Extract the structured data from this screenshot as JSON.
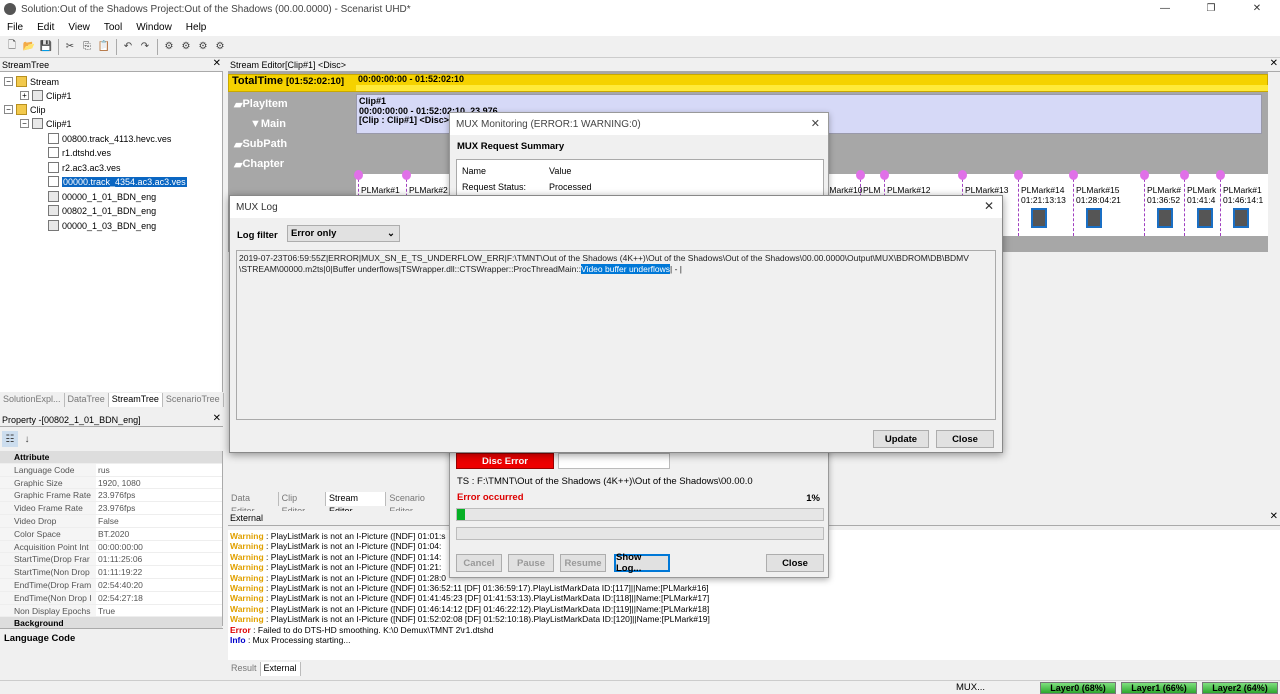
{
  "window": {
    "title": "Solution:Out of the Shadows  Project:Out of the Shadows (00.00.0000) - Scenarist UHD*",
    "min": "—",
    "restore": "❐",
    "close": "✕"
  },
  "menu": [
    "File",
    "Edit",
    "View",
    "Tool",
    "Window",
    "Help"
  ],
  "streamtree": {
    "header": "StreamTree",
    "pin": "📌",
    "close": "✕",
    "nodes": [
      {
        "label": "Stream",
        "box": "−"
      },
      {
        "label": "Clip#1",
        "box": "+"
      },
      {
        "label": "Clip",
        "box": "−"
      },
      {
        "label": "Clip#1",
        "box": "−"
      },
      {
        "label": "00800.track_4113.hevc.ves"
      },
      {
        "label": "r1.dtshd.ves"
      },
      {
        "label": "r2.ac3.ac3.ves"
      },
      {
        "label": "00000.track_4354.ac3.ac3.ves"
      },
      {
        "label": "00000_1_01_BDN_eng"
      },
      {
        "label": "00802_1_01_BDN_eng"
      },
      {
        "label": "00000_1_03_BDN_eng"
      }
    ],
    "tabs": [
      "SolutionExpl...",
      "DataTree",
      "StreamTree",
      "ScenarioTree"
    ]
  },
  "property": {
    "header": "Property -[00802_1_01_BDN_eng]",
    "pin": "📌",
    "close": "✕",
    "rows": [
      {
        "k": "Attribute",
        "v": "",
        "cat": true
      },
      {
        "k": "Language Code",
        "v": "rus"
      },
      {
        "k": "Graphic Size",
        "v": "1920, 1080"
      },
      {
        "k": "Graphic Frame Rate",
        "v": "23.976fps"
      },
      {
        "k": "Video Frame Rate",
        "v": "23.976fps"
      },
      {
        "k": "Video Drop",
        "v": "False"
      },
      {
        "k": "Color Space",
        "v": "BT.2020"
      },
      {
        "k": "Acquisition Point Int",
        "v": "00:00:00:00"
      },
      {
        "k": "StartTime(Drop Frar",
        "v": "01:11:25:06"
      },
      {
        "k": "StartTime(Non Drop",
        "v": "01:11:19:22"
      },
      {
        "k": "EndTime(Drop Fram",
        "v": "02:54:40:20"
      },
      {
        "k": "EndTime(Non Drop I",
        "v": "02:54:27:18"
      },
      {
        "k": "Non Display Epochs",
        "v": "True"
      },
      {
        "k": "Background",
        "v": "",
        "cat": true
      }
    ],
    "desc": "Language Code"
  },
  "streameditor": {
    "header": "Stream Editor[Clip#1] <Disc>",
    "total_label": "TotalTime",
    "total_time": "[01:52:02:10]",
    "range": "00:00:00:00 - 01:52:02:10",
    "rows": [
      "PlayItem",
      "Main",
      "SubPath",
      "Chapter"
    ],
    "playitem_lines": [
      "Clip#1",
      "00:00:00:00 - 01:52:02:10, 23.976",
      "[Clip : Clip#1] <Disc>"
    ],
    "marks": [
      {
        "n": "PLMark#1"
      },
      {
        "n": "PLMark#2"
      },
      {
        "n": "PLMark#10"
      },
      {
        "n": "PLM"
      },
      {
        "n": "PLMark#12"
      },
      {
        "n": "PLMark#13",
        "t": "08"
      },
      {
        "n": "PLMark#14",
        "t": "01:21:13:13"
      },
      {
        "n": "PLMark#15",
        "t": "01:28:04:21"
      },
      {
        "n": "PLMark#",
        "t": "01:36:52"
      },
      {
        "n": "PLMark",
        "t": "01:41:4"
      },
      {
        "n": "PLMark#1",
        "t": "01:46:14:1"
      }
    ],
    "tabs": [
      "Data Editor",
      "Clip Editor",
      "Stream Editor",
      "Scenario Editor"
    ]
  },
  "monitor": {
    "title": "MUX Monitoring  (ERROR:1 WARNING:0)",
    "summary": "MUX Request Summary",
    "col_name": "Name",
    "col_value": "Value",
    "rows": [
      {
        "n": "Request Status:",
        "v": "Processed"
      }
    ],
    "disc_error": "Disc Error",
    "ts_path": "TS : F:\\TMNT\\Out of the Shadows (4K++)\\Out of the Shadows\\00.00.0",
    "error_occurred": "Error occurred",
    "percent": "1%",
    "progress": 0.01,
    "buttons": {
      "cancel": "Cancel",
      "pause": "Pause",
      "resume": "Resume",
      "showlog": "Show Log...",
      "close": "Close"
    }
  },
  "muxlog": {
    "title": "MUX Log",
    "filter_label": "Log filter",
    "filter_value": "Error only",
    "line1": "2019-07-23T06:59:55Z|ERROR|MUX_SN_E_TS_UNDERFLOW_ERR|F:\\TMNT\\Out of the Shadows (4K++)\\Out of the Shadows\\Out of the Shadows\\00.00.0000\\Output\\MUX\\BDROM\\DB\\BDMV",
    "line2a": "\\STREAM\\00000.m2ts|0|Buffer underflows|TSWrapper.dll::CTSWrapper::ProcThreadMain::",
    "line2sel": "Video buffer underflows",
    "line2b": "| - |",
    "update": "Update",
    "close": "Close"
  },
  "external": {
    "header": "External",
    "lines": [
      {
        "t": "Warning",
        "m": " : PlayListMark is not an I-Picture ([NDF] 01:01:s"
      },
      {
        "t": "Warning",
        "m": " : PlayListMark is not an I-Picture ([NDF] 01:04:"
      },
      {
        "t": "Warning",
        "m": " : PlayListMark is not an I-Picture ([NDF] 01:14:"
      },
      {
        "t": "Warning",
        "m": " : PlayListMark is not an I-Picture ([NDF] 01:21:"
      },
      {
        "t": "Warning",
        "m": " : PlayListMark is not an I-Picture ([NDF] 01:28:0"
      },
      {
        "t": "Warning",
        "m": " : PlayListMark is not an I-Picture ([NDF] 01:36:52:11  [DF] 01:36:59:17).PlayListMarkData ID:[117]||Name:[PLMark#16]"
      },
      {
        "t": "Warning",
        "m": " : PlayListMark is not an I-Picture ([NDF] 01:41:45:23  [DF] 01:41:53:13).PlayListMarkData ID:[118]||Name:[PLMark#17]"
      },
      {
        "t": "Warning",
        "m": " : PlayListMark is not an I-Picture ([NDF] 01:46:14:12  [DF] 01:46:22:12).PlayListMarkData ID:[119]||Name:[PLMark#18]"
      },
      {
        "t": "Warning",
        "m": " : PlayListMark is not an I-Picture ([NDF] 01:52:02:08  [DF] 01:52:10:18).PlayListMarkData ID:[120]||Name:[PLMark#19]"
      },
      {
        "t": "Error",
        "m": " : Failed to do DTS-HD smoothing. K:\\0 Demux\\TMNT 2\\r1.dtshd"
      },
      {
        "t": "Info",
        "m": " : Mux Processing starting..."
      }
    ],
    "tabs": [
      "Result",
      "External"
    ]
  },
  "status": {
    "mux": "MUX...",
    "layer0": "Layer0 (68%)",
    "layer1": "Layer1 (66%)",
    "layer2": "Layer2 (64%)"
  }
}
